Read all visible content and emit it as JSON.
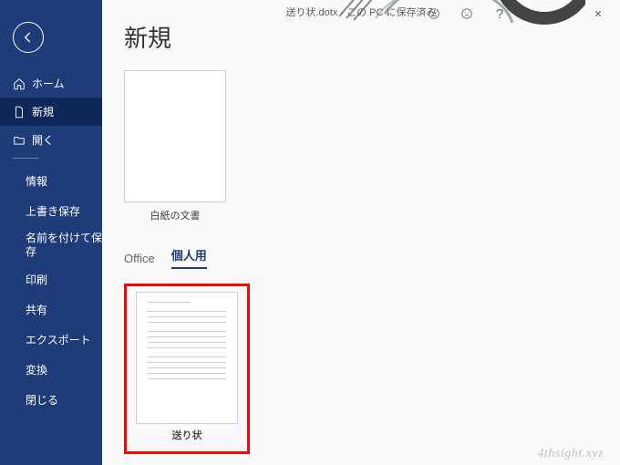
{
  "titlebar": {
    "filename": "送り状.dotx",
    "status": "この PC に保存済み"
  },
  "sidebar": {
    "home": "ホーム",
    "new": "新規",
    "open": "開く",
    "info": "情報",
    "save_overwrite": "上書き保存",
    "save_as": "名前を付けて保存",
    "print": "印刷",
    "share": "共有",
    "export": "エクスポート",
    "transform": "変換",
    "close": "閉じる"
  },
  "main": {
    "heading": "新規",
    "blank_template": "白紙の文書",
    "tabs": {
      "office": "Office",
      "personal": "個人用"
    },
    "personal_template": "送り状"
  },
  "watermark": "4thsight.xyz"
}
